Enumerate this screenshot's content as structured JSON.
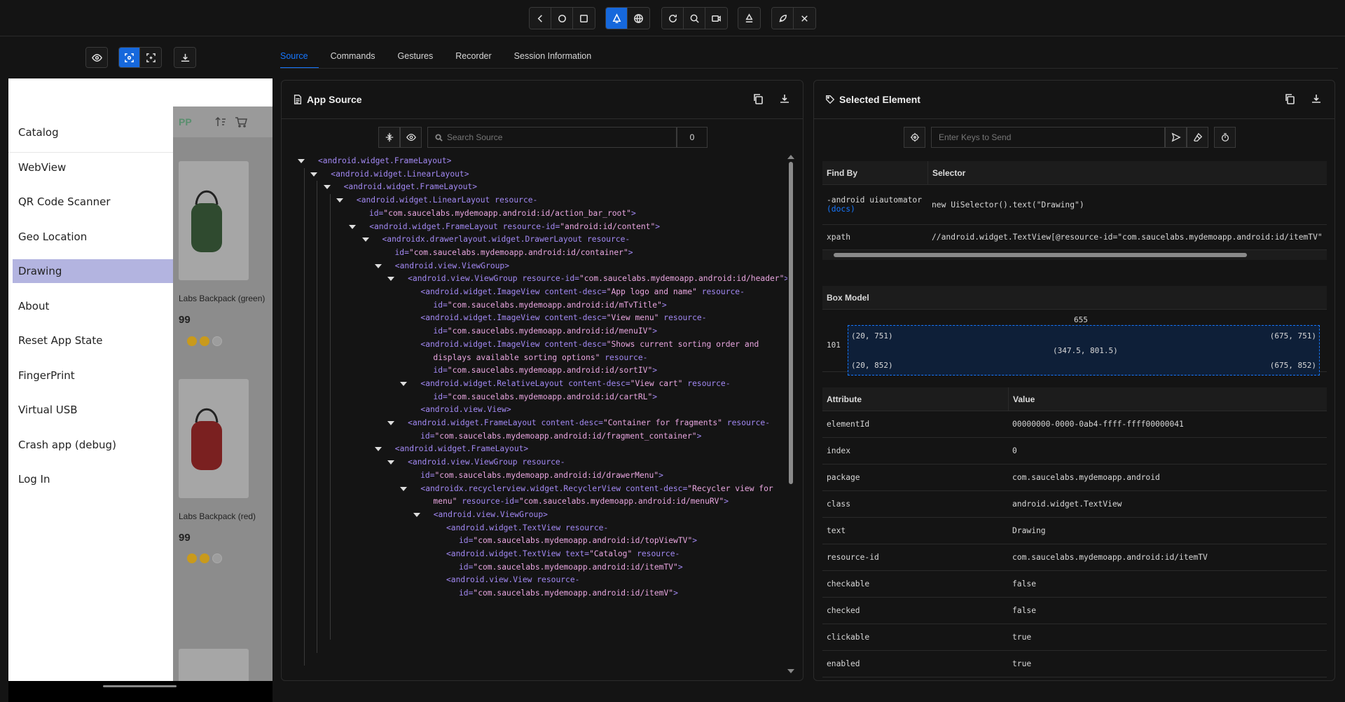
{
  "toolbar": {
    "groups": [
      [
        "back-icon",
        "home-icon",
        "app-switch-icon"
      ],
      [
        "native-context-icon",
        "web-context-icon"
      ],
      [
        "refresh-icon",
        "search-icon",
        "record-icon"
      ],
      [
        "recycle-icon"
      ],
      [
        "rocket-icon",
        "close-icon"
      ]
    ]
  },
  "device": {
    "app_logo": "PP",
    "drawer_items": [
      "Catalog",
      "WebView",
      "QR Code Scanner",
      "Geo Location",
      "Drawing",
      "About",
      "Reset App State",
      "FingerPrint",
      "Virtual USB",
      "Crash app (debug)",
      "Log In"
    ],
    "selected_item": "Drawing",
    "products": [
      {
        "title": "Labs Backpack (green)",
        "price": "99",
        "pack_color": "#2f4a2f"
      },
      {
        "title": "Labs Backpack (red)",
        "price": "99",
        "pack_color": "#7a2020"
      }
    ]
  },
  "tabs": [
    "Source",
    "Commands",
    "Gestures",
    "Recorder",
    "Session Information"
  ],
  "active_tab": "Source",
  "source": {
    "title": "App Source",
    "search_placeholder": "Search Source",
    "match_count": "0"
  },
  "tree": [
    {
      "i": 0,
      "a": 1,
      "lines": [
        [
          [
            "t",
            "<android.widget.FrameLayout>"
          ]
        ]
      ]
    },
    {
      "i": 1,
      "a": 1,
      "lines": [
        [
          [
            "t",
            "<android.widget.LinearLayout>"
          ]
        ]
      ]
    },
    {
      "i": 2,
      "a": 1,
      "lines": [
        [
          [
            "t",
            "<android.widget.FrameLayout>"
          ]
        ]
      ]
    },
    {
      "i": 3,
      "a": 1,
      "lines": [
        [
          [
            "t",
            "<android.widget.LinearLayout "
          ],
          [
            "a",
            "resource-"
          ]
        ],
        [
          [
            "a",
            "id="
          ],
          [
            "v",
            "\"com.saucelabs.mydemoapp.android:id/action_bar_root\""
          ],
          [
            "t",
            ">"
          ]
        ]
      ]
    },
    {
      "i": 4,
      "a": 1,
      "lines": [
        [
          [
            "t",
            "<android.widget.FrameLayout "
          ],
          [
            "a",
            "resource-id="
          ],
          [
            "v",
            "\"android:id/content\""
          ],
          [
            "t",
            ">"
          ]
        ]
      ]
    },
    {
      "i": 5,
      "a": 1,
      "lines": [
        [
          [
            "t",
            "<androidx.drawerlayout.widget.DrawerLayout "
          ],
          [
            "a",
            "resource-"
          ]
        ],
        [
          [
            "a",
            "id="
          ],
          [
            "v",
            "\"com.saucelabs.mydemoapp.android:id/container\""
          ],
          [
            "t",
            ">"
          ]
        ]
      ]
    },
    {
      "i": 6,
      "a": 1,
      "lines": [
        [
          [
            "t",
            "<android.view.ViewGroup>"
          ]
        ]
      ]
    },
    {
      "i": 7,
      "a": 1,
      "lines": [
        [
          [
            "t",
            "<android.view.ViewGroup "
          ],
          [
            "a",
            "resource-id="
          ],
          [
            "v",
            "\"com.saucelabs.mydemoapp.android:id/header\""
          ],
          [
            "t",
            ">"
          ]
        ]
      ]
    },
    {
      "i": 8,
      "a": 0,
      "lines": [
        [
          [
            "t",
            "<android.widget.ImageView "
          ],
          [
            "a",
            "content-desc="
          ],
          [
            "v",
            "\"App logo and name\""
          ],
          [
            "a",
            " resource-"
          ]
        ],
        [
          [
            "a",
            "id="
          ],
          [
            "v",
            "\"com.saucelabs.mydemoapp.android:id/mTvTitle\""
          ],
          [
            "t",
            ">"
          ]
        ]
      ]
    },
    {
      "i": 8,
      "a": 0,
      "lines": [
        [
          [
            "t",
            "<android.widget.ImageView "
          ],
          [
            "a",
            "content-desc="
          ],
          [
            "v",
            "\"View menu\""
          ],
          [
            "a",
            " resource-"
          ]
        ],
        [
          [
            "a",
            "id="
          ],
          [
            "v",
            "\"com.saucelabs.mydemoapp.android:id/menuIV\""
          ],
          [
            "t",
            ">"
          ]
        ]
      ]
    },
    {
      "i": 8,
      "a": 0,
      "lines": [
        [
          [
            "t",
            "<android.widget.ImageView "
          ],
          [
            "a",
            "content-desc="
          ],
          [
            "v",
            "\"Shows current sorting order and"
          ]
        ],
        [
          [
            "v",
            "displays available sorting options\""
          ],
          [
            "a",
            " resource-"
          ]
        ],
        [
          [
            "a",
            "id="
          ],
          [
            "v",
            "\"com.saucelabs.mydemoapp.android:id/sortIV\""
          ],
          [
            "t",
            ">"
          ]
        ]
      ]
    },
    {
      "i": 8,
      "a": 1,
      "lines": [
        [
          [
            "t",
            "<android.widget.RelativeLayout "
          ],
          [
            "a",
            "content-desc="
          ],
          [
            "v",
            "\"View cart\""
          ],
          [
            "a",
            " resource-"
          ]
        ],
        [
          [
            "a",
            "id="
          ],
          [
            "v",
            "\"com.saucelabs.mydemoapp.android:id/cartRL\""
          ],
          [
            "t",
            ">"
          ]
        ]
      ]
    },
    {
      "i": 8,
      "a": 0,
      "lines": [
        [
          [
            "t",
            "<android.view.View>"
          ]
        ]
      ]
    },
    {
      "i": 7,
      "a": 1,
      "lines": [
        [
          [
            "t",
            "<android.widget.FrameLayout "
          ],
          [
            "a",
            "content-desc="
          ],
          [
            "v",
            "\"Container for fragments\""
          ],
          [
            "a",
            " resource-"
          ]
        ],
        [
          [
            "a",
            "id="
          ],
          [
            "v",
            "\"com.saucelabs.mydemoapp.android:id/fragment_container\""
          ],
          [
            "t",
            ">"
          ]
        ]
      ]
    },
    {
      "i": 6,
      "a": 1,
      "lines": [
        [
          [
            "t",
            "<android.widget.FrameLayout>"
          ]
        ]
      ]
    },
    {
      "i": 7,
      "a": 1,
      "lines": [
        [
          [
            "t",
            "<android.view.ViewGroup "
          ],
          [
            "a",
            "resource-"
          ]
        ],
        [
          [
            "a",
            "id="
          ],
          [
            "v",
            "\"com.saucelabs.mydemoapp.android:id/drawerMenu\""
          ],
          [
            "t",
            ">"
          ]
        ]
      ]
    },
    {
      "i": 8,
      "a": 1,
      "lines": [
        [
          [
            "t",
            "<androidx.recyclerview.widget.RecyclerView "
          ],
          [
            "a",
            "content-desc="
          ],
          [
            "v",
            "\"Recycler view for"
          ]
        ],
        [
          [
            "v",
            "menu\""
          ],
          [
            "a",
            " resource-id="
          ],
          [
            "v",
            "\"com.saucelabs.mydemoapp.android:id/menuRV\""
          ],
          [
            "t",
            ">"
          ]
        ]
      ]
    },
    {
      "i": 9,
      "a": 1,
      "lines": [
        [
          [
            "t",
            "<android.view.ViewGroup>"
          ]
        ]
      ]
    },
    {
      "i": 10,
      "a": 0,
      "lines": [
        [
          [
            "t",
            "<android.widget.TextView "
          ],
          [
            "a",
            "resource-"
          ]
        ],
        [
          [
            "a",
            "id="
          ],
          [
            "v",
            "\"com.saucelabs.mydemoapp.android:id/topViewTV\""
          ],
          [
            "t",
            ">"
          ]
        ]
      ]
    },
    {
      "i": 10,
      "a": 0,
      "lines": [
        [
          [
            "t",
            "<android.widget.TextView "
          ],
          [
            "a",
            "text="
          ],
          [
            "v",
            "\"Catalog\""
          ],
          [
            "a",
            " resource-"
          ]
        ],
        [
          [
            "a",
            "id="
          ],
          [
            "v",
            "\"com.saucelabs.mydemoapp.android:id/itemTV\""
          ],
          [
            "t",
            ">"
          ]
        ]
      ]
    },
    {
      "i": 10,
      "a": 0,
      "lines": [
        [
          [
            "t",
            "<android.view.View "
          ],
          [
            "a",
            "resource-"
          ]
        ],
        [
          [
            "a",
            "id="
          ],
          [
            "v",
            "\"com.saucelabs.mydemoapp.android:id/itemV\""
          ],
          [
            "t",
            ">"
          ]
        ]
      ]
    }
  ],
  "selected": {
    "title": "Selected Element",
    "keys_placeholder": "Enter Keys to Send",
    "findby_header": [
      "Find By",
      "Selector"
    ],
    "findby": [
      {
        "by": "-android uiautomator",
        "docs": "(docs)",
        "selector": "new UiSelector().text(\"Drawing\")"
      },
      {
        "by": "xpath",
        "docs": "",
        "selector": "//android.widget.TextView[@resource-id=\"com.saucelabs.mydemoapp.android:id/itemTV\" and"
      }
    ],
    "box_model": {
      "title": "Box Model",
      "width": "655",
      "height": "101",
      "tl": "(20, 751)",
      "tr": "(675, 751)",
      "center": "(347.5, 801.5)",
      "bl": "(20, 852)",
      "br": "(675, 852)"
    },
    "attr_header": [
      "Attribute",
      "Value"
    ],
    "attributes": [
      [
        "elementId",
        "00000000-0000-0ab4-ffff-ffff00000041"
      ],
      [
        "index",
        "0"
      ],
      [
        "package",
        "com.saucelabs.mydemoapp.android"
      ],
      [
        "class",
        "android.widget.TextView"
      ],
      [
        "text",
        "Drawing"
      ],
      [
        "resource-id",
        "com.saucelabs.mydemoapp.android:id/itemTV"
      ],
      [
        "checkable",
        "false"
      ],
      [
        "checked",
        "false"
      ],
      [
        "clickable",
        "true"
      ],
      [
        "enabled",
        "true"
      ]
    ]
  },
  "colors": {
    "accent": "#1677ff",
    "selected_menu": "#b3b4e0",
    "tag": "#a389f4",
    "value": "#e9a6e0"
  }
}
